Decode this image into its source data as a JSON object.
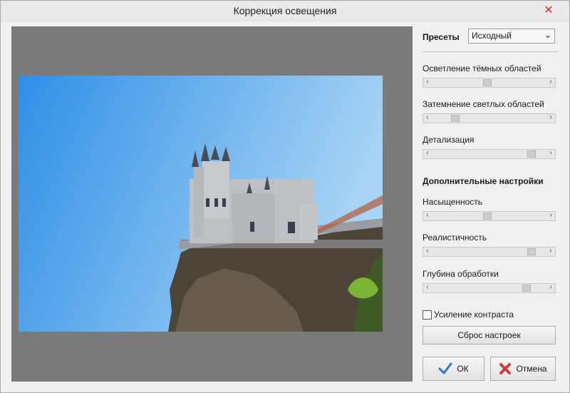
{
  "window": {
    "title": "Коррекция освещения",
    "close_glyph": "✕"
  },
  "presets": {
    "label": "Пресеты",
    "selected": "Исходный",
    "arrow": "⌄"
  },
  "sliders": [
    {
      "label": "Осветление тёмных областей",
      "value": 0.48
    },
    {
      "label": "Затемнение светлых областей",
      "value": 0.18
    },
    {
      "label": "Детализация",
      "value": 0.9
    }
  ],
  "advanced": {
    "title": "Дополнительные настройки",
    "sliders": [
      {
        "label": "Насыщенность",
        "value": 0.48
      },
      {
        "label": "Реалистичность",
        "value": 0.9
      },
      {
        "label": "Глубина обработки",
        "value": 0.85
      }
    ]
  },
  "contrast": {
    "label": "Усиление контраста",
    "checked": false
  },
  "buttons": {
    "reset": "Сброс настроек",
    "ok": "ОК",
    "cancel": "Отмена"
  },
  "colors": {
    "sky_top": "#2f8fe6",
    "sky_bottom": "#9fd0f3",
    "ok_check": "#2d74d2",
    "cancel_x": "#d33a3a"
  }
}
